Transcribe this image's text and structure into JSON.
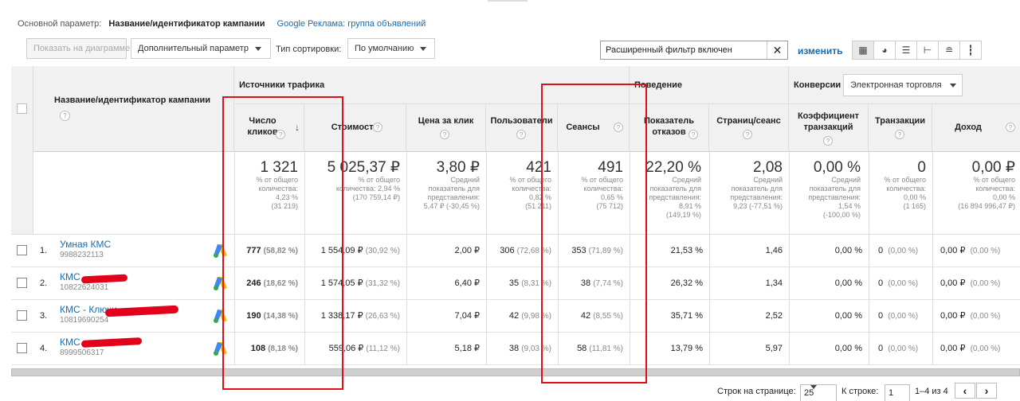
{
  "dimension": {
    "label": "Основной параметр:",
    "current": "Название/идентификатор кампании",
    "alternative": "Google Реклама: группа объявлений"
  },
  "toolbar": {
    "plot_rows": "Показать на диаграмме",
    "secondary_dimension": "Дополнительный параметр",
    "sort_label": "Тип сортировки:",
    "sort_value": "По умолчанию",
    "filter_text": "Расширенный фильтр включен",
    "filter_clear": "✕",
    "change_link": "изменить",
    "view_icons": [
      "table-view-icon",
      "pie-view-icon",
      "performance-view-icon",
      "comparison-view-icon",
      "term-cloud-icon",
      "pivot-view-icon"
    ]
  },
  "table": {
    "campaign_header": "Название/идентификатор кампании",
    "groups": {
      "acquisition": "Источники трафика",
      "behavior": "Поведение",
      "conversions": "Конверсии",
      "conversion_select": "Электронная торговля"
    },
    "columns": [
      {
        "label": "Число кликов"
      },
      {
        "label": "Стоимость"
      },
      {
        "label": "Цена за клик"
      },
      {
        "label": "Пользователи"
      },
      {
        "label": "Сеансы"
      },
      {
        "label": "Показатель отказов"
      },
      {
        "label": "Страниц/сеанс"
      },
      {
        "label": "Коэффициент транзакций"
      },
      {
        "label": "Транзакции"
      },
      {
        "label": "Доход"
      }
    ],
    "totals": [
      {
        "big": "1 321",
        "small": [
          "% от общего",
          "количества:",
          "4,23 %",
          "(31 219)"
        ]
      },
      {
        "big": "5 025,37 ₽",
        "small": [
          "% от общего",
          "количества: 2,94 %",
          "(170 759,14 ₽)"
        ]
      },
      {
        "big": "3,80 ₽",
        "small": [
          "Средний",
          "показатель для",
          "представления:",
          "5,47 ₽ (-30,45 %)"
        ]
      },
      {
        "big": "421",
        "small": [
          "% от общего",
          "количества:",
          "0,82 %",
          "(51 211)"
        ]
      },
      {
        "big": "491",
        "small": [
          "% от общего",
          "количества:",
          "0,65 %",
          "(75 712)"
        ]
      },
      {
        "big": "22,20 %",
        "small": [
          "Средний",
          "показатель для",
          "представления:",
          "8,91 %",
          "(149,19 %)"
        ]
      },
      {
        "big": "2,08",
        "small": [
          "Средний",
          "показатель для",
          "представления:",
          "9,23 (-77,51 %)"
        ]
      },
      {
        "big": "0,00 %",
        "small": [
          "Средний",
          "показатель для",
          "представления:",
          "1,54 %",
          "(-100,00 %)"
        ]
      },
      {
        "big": "0",
        "small": [
          "% от общего",
          "количества:",
          "0,00 %",
          "(1 165)"
        ]
      },
      {
        "big": "0,00 ₽",
        "small": [
          "% от общего",
          "количества:",
          "0,00 %",
          "(16 894 996,47 ₽)"
        ]
      }
    ],
    "rows": [
      {
        "num": "1.",
        "name": "Умная КМС",
        "id": "9988232113",
        "clicks": "777",
        "clicks_pct": "(58,82 %)",
        "cost": "1 554,09 ₽",
        "cost_pct": "(30,92 %)",
        "cpc": "2,00 ₽",
        "users": "306",
        "users_pct": "(72,68 %)",
        "sessions": "353",
        "sessions_pct": "(71,89 %)",
        "bounce": "21,53 %",
        "pages": "1,46",
        "conv": "0,00 %",
        "trans": "0",
        "trans_pct": "(0,00 %)",
        "rev": "0,00 ₽",
        "rev_pct": "(0,00 %)"
      },
      {
        "num": "2.",
        "name": "КМС",
        "id": "10822624031",
        "clicks": "246",
        "clicks_pct": "(18,62 %)",
        "cost": "1 574,05 ₽",
        "cost_pct": "(31,32 %)",
        "cpc": "6,40 ₽",
        "users": "35",
        "users_pct": "(8,31 %)",
        "sessions": "38",
        "sessions_pct": "(7,74 %)",
        "bounce": "26,32 %",
        "pages": "1,34",
        "conv": "0,00 %",
        "trans": "0",
        "trans_pct": "(0,00 %)",
        "rev": "0,00 ₽",
        "rev_pct": "(0,00 %)"
      },
      {
        "num": "3.",
        "name": "КМС - Ключи",
        "id": "10819690254",
        "clicks": "190",
        "clicks_pct": "(14,38 %)",
        "cost": "1 338,17 ₽",
        "cost_pct": "(26,63 %)",
        "cpc": "7,04 ₽",
        "users": "42",
        "users_pct": "(9,98 %)",
        "sessions": "42",
        "sessions_pct": "(8,55 %)",
        "bounce": "35,71 %",
        "pages": "2,52",
        "conv": "0,00 %",
        "trans": "0",
        "trans_pct": "(0,00 %)",
        "rev": "0,00 ₽",
        "rev_pct": "(0,00 %)"
      },
      {
        "num": "4.",
        "name": "КМС",
        "id": "8999506317",
        "clicks": "108",
        "clicks_pct": "(8,18 %)",
        "cost": "559,06 ₽",
        "cost_pct": "(11,12 %)",
        "cpc": "5,18 ₽",
        "users": "38",
        "users_pct": "(9,03 %)",
        "sessions": "58",
        "sessions_pct": "(11,81 %)",
        "bounce": "13,79 %",
        "pages": "5,97",
        "conv": "0,00 %",
        "trans": "0",
        "trans_pct": "(0,00 %)",
        "rev": "0,00 ₽",
        "rev_pct": "(0,00 %)"
      }
    ]
  },
  "pager": {
    "rows_label": "Строк на странице:",
    "rows_value": "25",
    "goto_label": "К строке:",
    "goto_value": "1",
    "range": "1–4 из 4",
    "prev": "‹",
    "next": "›"
  },
  "annotation_color": "#e0101a",
  "redaction_color": "#e2001a"
}
